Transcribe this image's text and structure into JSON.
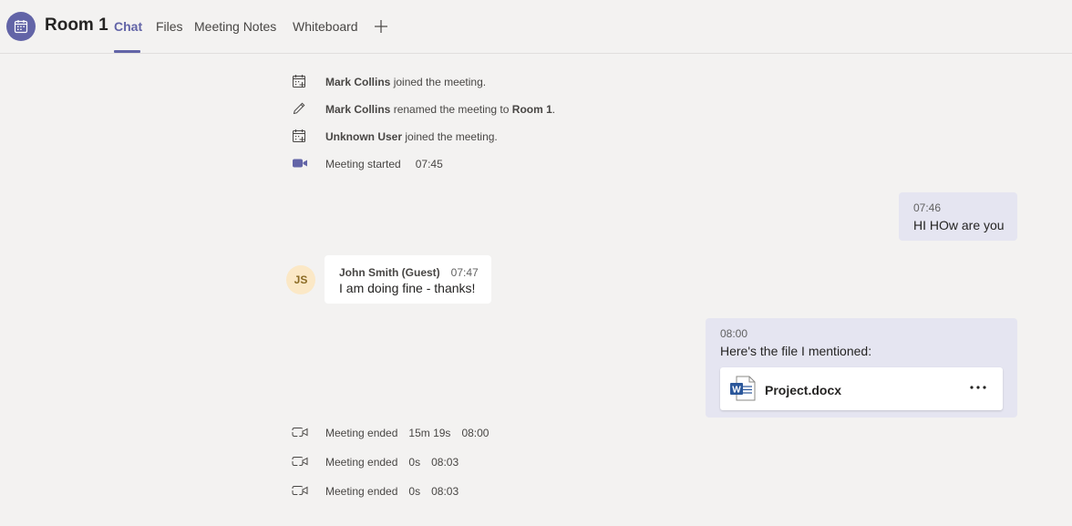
{
  "header": {
    "icon": "calendar-icon",
    "title": "Room 1",
    "tabs": [
      "Chat",
      "Files",
      "Meeting Notes",
      "Whiteboard"
    ],
    "active_tab": "Chat",
    "add_tab_icon": "plus-icon"
  },
  "events_top": [
    {
      "icon": "calendar-add-icon",
      "name": "Mark Collins",
      "text": " joined the meeting."
    },
    {
      "icon": "pencil-icon",
      "name": "Mark Collins",
      "text": " renamed the meeting to ",
      "target": "Room 1",
      "suffix": "."
    },
    {
      "icon": "calendar-add-icon",
      "name": "Unknown User",
      "text": " joined the meeting."
    },
    {
      "icon": "video-camera-icon",
      "label": "Meeting started",
      "time": "07:45"
    }
  ],
  "messages": [
    {
      "from": "me",
      "time": "07:46",
      "text": "HI HOw are you"
    },
    {
      "from": "other",
      "sender": "John Smith (Guest)",
      "initials": "JS",
      "time": "07:47",
      "text": "I am doing fine - thanks!"
    },
    {
      "from": "me",
      "time": "08:00",
      "text": "Here's the file I mentioned:",
      "attachment": {
        "icon": "word-document-icon",
        "name": "Project.docx",
        "more_icon": "more-options-icon"
      }
    }
  ],
  "events_bottom": [
    {
      "icon": "video-ended-icon",
      "label": "Meeting ended",
      "duration": "15m 19s",
      "time": "08:00"
    },
    {
      "icon": "video-ended-icon",
      "label": "Meeting ended",
      "duration": "0s",
      "time": "08:03"
    },
    {
      "icon": "video-ended-icon",
      "label": "Meeting ended",
      "duration": "0s",
      "time": "08:03"
    }
  ],
  "colors": {
    "accent": "#6264a7",
    "background": "#f3f2f1",
    "my_bubble": "#e5e5f1",
    "other_bubble": "#ffffff"
  }
}
